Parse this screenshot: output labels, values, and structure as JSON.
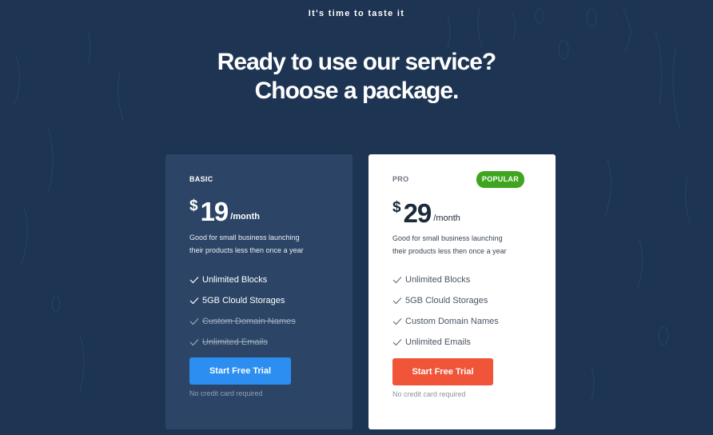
{
  "eyebrow": "It's time to taste it",
  "headline": {
    "line1": "Ready to use our service?",
    "line2": "Choose a package."
  },
  "plans": [
    {
      "name": "BASIC",
      "currency": "$",
      "amount": "19",
      "period": "/month",
      "description_line1": "Good for small business launching",
      "description_line2": "their products less then once a year",
      "features": [
        {
          "label": "Unlimited Blocks",
          "included": true
        },
        {
          "label": "5GB Clould Storages",
          "included": true
        },
        {
          "label": "Custom Domain Names",
          "included": false
        },
        {
          "label": "Unlimited Emails",
          "included": false
        }
      ],
      "cta_label": "Start Free Trial",
      "note": "No credit card required"
    },
    {
      "name": "PRO",
      "badge": "POPULAR",
      "currency": "$",
      "amount": "29",
      "period": "/month",
      "description_line1": "Good for small business launching",
      "description_line2": "their products less then once a year",
      "features": [
        {
          "label": "Unlimited Blocks",
          "included": true
        },
        {
          "label": "5GB Clould Storages",
          "included": true
        },
        {
          "label": "Custom Domain Names",
          "included": true
        },
        {
          "label": "Unlimited Emails",
          "included": true
        }
      ],
      "cta_label": "Start Free Trial",
      "note": "No credit card required"
    }
  ],
  "colors": {
    "background": "#1d3453",
    "basic_card": "#2c4566",
    "basic_cta": "#2b8ef0",
    "pro_cta": "#f0553a",
    "badge": "#3fa51f"
  },
  "icons": {
    "feature": "check-icon"
  }
}
